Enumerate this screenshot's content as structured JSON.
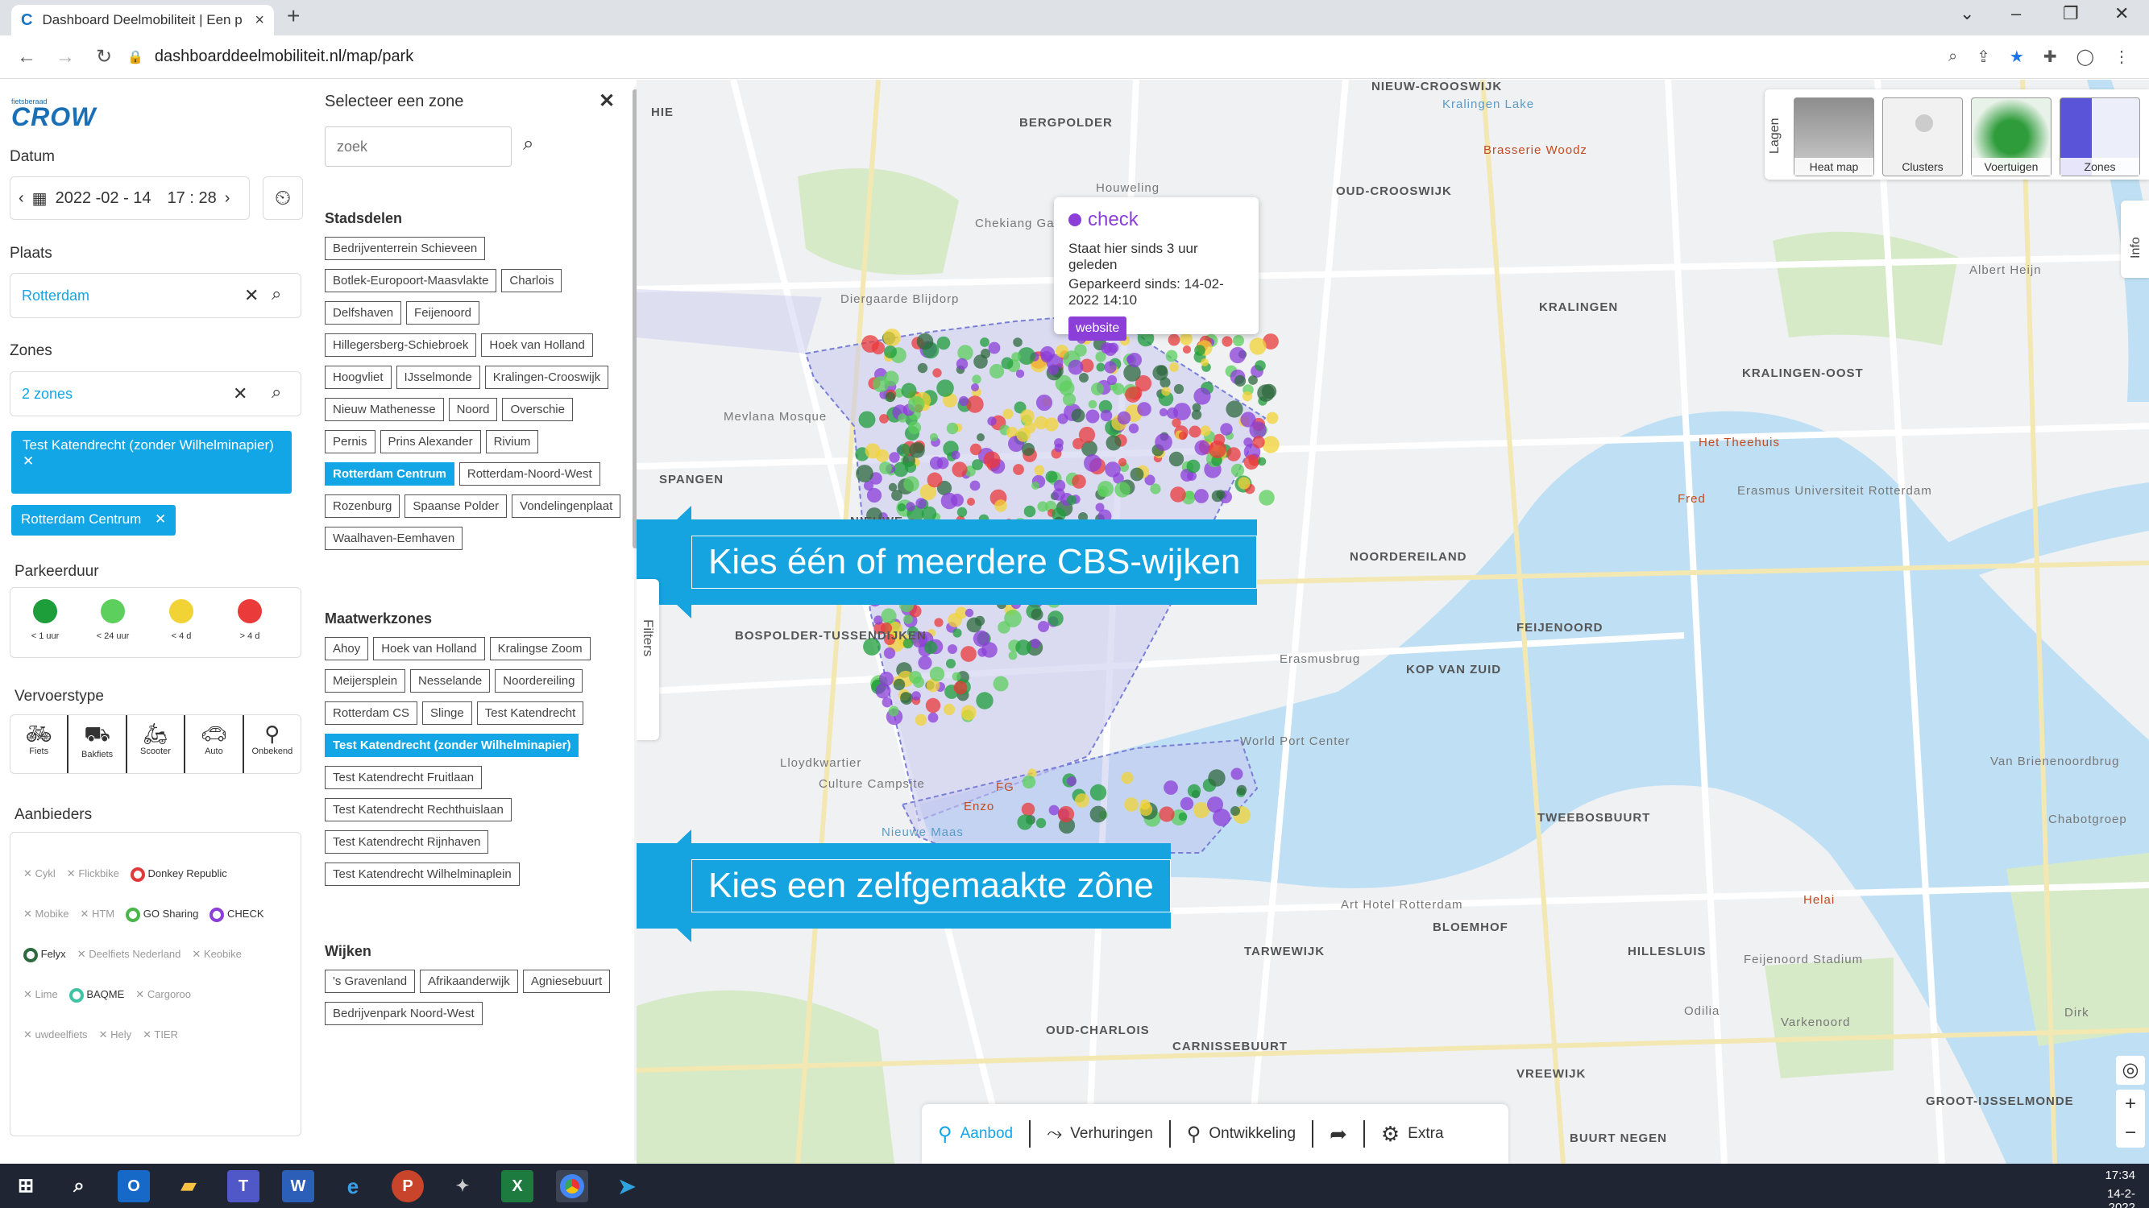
{
  "browser": {
    "tab_title": "Dashboard Deelmobiliteit | Een p",
    "tab_icon": "C",
    "url": "dashboarddeelmobiliteit.nl/map/park"
  },
  "sidebar": {
    "logo_small": "fietsberaad",
    "logo": "CROW",
    "datum_label": "Datum",
    "date_value": "2022 -02 - 14",
    "time_value": "17 : 28",
    "plaats_label": "Plaats",
    "plaats_value": "Rotterdam",
    "zones_label": "Zones",
    "zones_value": "2 zones",
    "selected_zones": [
      "Test Katendrecht (zonder Wilhelminapier)",
      "Rotterdam Centrum"
    ],
    "parkeerduur_label": "Parkeerduur",
    "parkeerduur": [
      {
        "label": "< 1 uur",
        "color": "#1e9e3a"
      },
      {
        "label": "< 24 uur",
        "color": "#5ccf5c"
      },
      {
        "label": "< 4 d",
        "color": "#f2d335"
      },
      {
        "label": "> 4 d",
        "color": "#ea3a3a"
      }
    ],
    "vervoerstype_label": "Vervoerstype",
    "vervoerstypes": [
      "Fiets",
      "Bakfiets",
      "Scooter",
      "Auto",
      "Onbekend"
    ],
    "aanbieders_label": "Aanbieders",
    "aanbieders": [
      {
        "name": "Cykl",
        "active": false
      },
      {
        "name": "Flickbike",
        "active": false
      },
      {
        "name": "Donkey Republic",
        "active": true,
        "color": "#e03a3a"
      },
      {
        "name": "Mobike",
        "active": false
      },
      {
        "name": "HTM",
        "active": false
      },
      {
        "name": "GO Sharing",
        "active": true,
        "color": "#49b649"
      },
      {
        "name": "CHECK",
        "active": true,
        "color": "#8b3ed8"
      },
      {
        "name": "Felyx",
        "active": true,
        "color": "#2d6a3e"
      },
      {
        "name": "Deelfiets Nederland",
        "active": false
      },
      {
        "name": "Keobike",
        "active": false
      },
      {
        "name": "Lime",
        "active": false
      },
      {
        "name": "BAQME",
        "active": true,
        "color": "#3fc3a3"
      },
      {
        "name": "Cargoroo",
        "active": false
      },
      {
        "name": "uwdeelfiets",
        "active": false
      },
      {
        "name": "Hely",
        "active": false
      },
      {
        "name": "TIER",
        "active": false
      }
    ]
  },
  "zonepanel": {
    "title": "Selecteer een zone",
    "search_placeholder": "zoek",
    "stadsdelen_title": "Stadsdelen",
    "stadsdelen": [
      "Bedrijventerrein Schieveen",
      "Botlek-Europoort-Maasvlakte",
      "Charlois",
      "Delfshaven",
      "Feijenoord",
      "Hillegersberg-Schiebroek",
      "Hoek van Holland",
      "Hoogvliet",
      "IJsselmonde",
      "Kralingen-Crooswijk",
      "Nieuw Mathenesse",
      "Noord",
      "Overschie",
      "Pernis",
      "Prins Alexander",
      "Rivium",
      "Rotterdam Centrum",
      "Rotterdam-Noord-West",
      "Rozenburg",
      "Spaanse Polder",
      "Vondelingenplaat",
      "Waalhaven-Eemhaven"
    ],
    "stadsdelen_selected": "Rotterdam Centrum",
    "maatwerk_title": "Maatwerkzones",
    "maatwerk": [
      "Ahoy",
      "Hoek van Holland",
      "Kralingse Zoom",
      "Meijersplein",
      "Nesselande",
      "Noordereiling",
      "Rotterdam CS",
      "Slinge",
      "Test Katendrecht",
      "Test Katendrecht (zonder Wilhelminapier)",
      "Test Katendrecht Fruitlaan",
      "Test Katendrecht Rechthuislaan",
      "Test Katendrecht Rijnhaven",
      "Test Katendrecht Wilhelminaplein"
    ],
    "maatwerk_selected": "Test Katendrecht (zonder Wilhelminapier)",
    "wijken_title": "Wijken",
    "wijken": [
      "'s Gravenland",
      "Afrikaanderwijk",
      "Agniesebuurt",
      "Bedrijvenpark Noord-West"
    ],
    "filters_label": "Filters"
  },
  "map": {
    "popup": {
      "title": "check",
      "line1": "Staat hier sinds 3 uur geleden",
      "line2": "Geparkeerd sinds: 14-02-2022 14:10",
      "button": "website"
    },
    "callout1": "Kies één of meerdere CBS-wijken",
    "callout2": "Kies een zelfgemaakte zône",
    "layers_label": "Lagen",
    "layers": [
      "Heat map",
      "Clusters",
      "Voertuigen",
      "Zones"
    ],
    "info_label": "Info",
    "labels": [
      "BERGPOLDER",
      "HIE",
      "NIEUW-CROOSWIJK",
      "OUD-CROOSWIJK",
      "KRALINGEN",
      "KRALINGEN-OOST",
      "SPANGEN",
      "NIEUWE",
      "NOORDEREILAND",
      "BOSPOLDER-TUSSENDIJKEN",
      "FEIJENOORD",
      "KOP VAN ZUID",
      "TWEEBOSBUURT",
      "BLOEMHOF",
      "HILLESLUIS",
      "TARWEWIJK",
      "OUD-CHARLOIS",
      "CARNISSEBUURT",
      "VREEWIJK",
      "GROOT-IJSSELMONDE",
      "BUURT NEGEN"
    ],
    "pois": [
      "Houweling",
      "Chekiang Garden",
      "Diergaarde Blijdorp",
      "Mevlana Mosque",
      "Brasserie Woodz",
      "Albert Heijn",
      "Het Theehuis",
      "Fred",
      "Erasmus Universiteit Rotterdam",
      "Erasmusbrug",
      "World Port Center",
      "Lloydkwartier",
      "Culture Campsite",
      "FG",
      "Enzo",
      "Art Hotel Rotterdam",
      "Van Brienenoordbrug",
      "Chabotgroep",
      "Helai",
      "Feijenoord Stadium",
      "Odilia",
      "Varkenoord",
      "Dirk",
      "Kralingen Lake",
      "Nieuwe Maas"
    ]
  },
  "bottombar": [
    "Aanbod",
    "Verhuringen",
    "Ontwikkeling",
    "",
    "Extra"
  ],
  "taskbar": {
    "time": "17:34",
    "date": "14-2-2022"
  }
}
